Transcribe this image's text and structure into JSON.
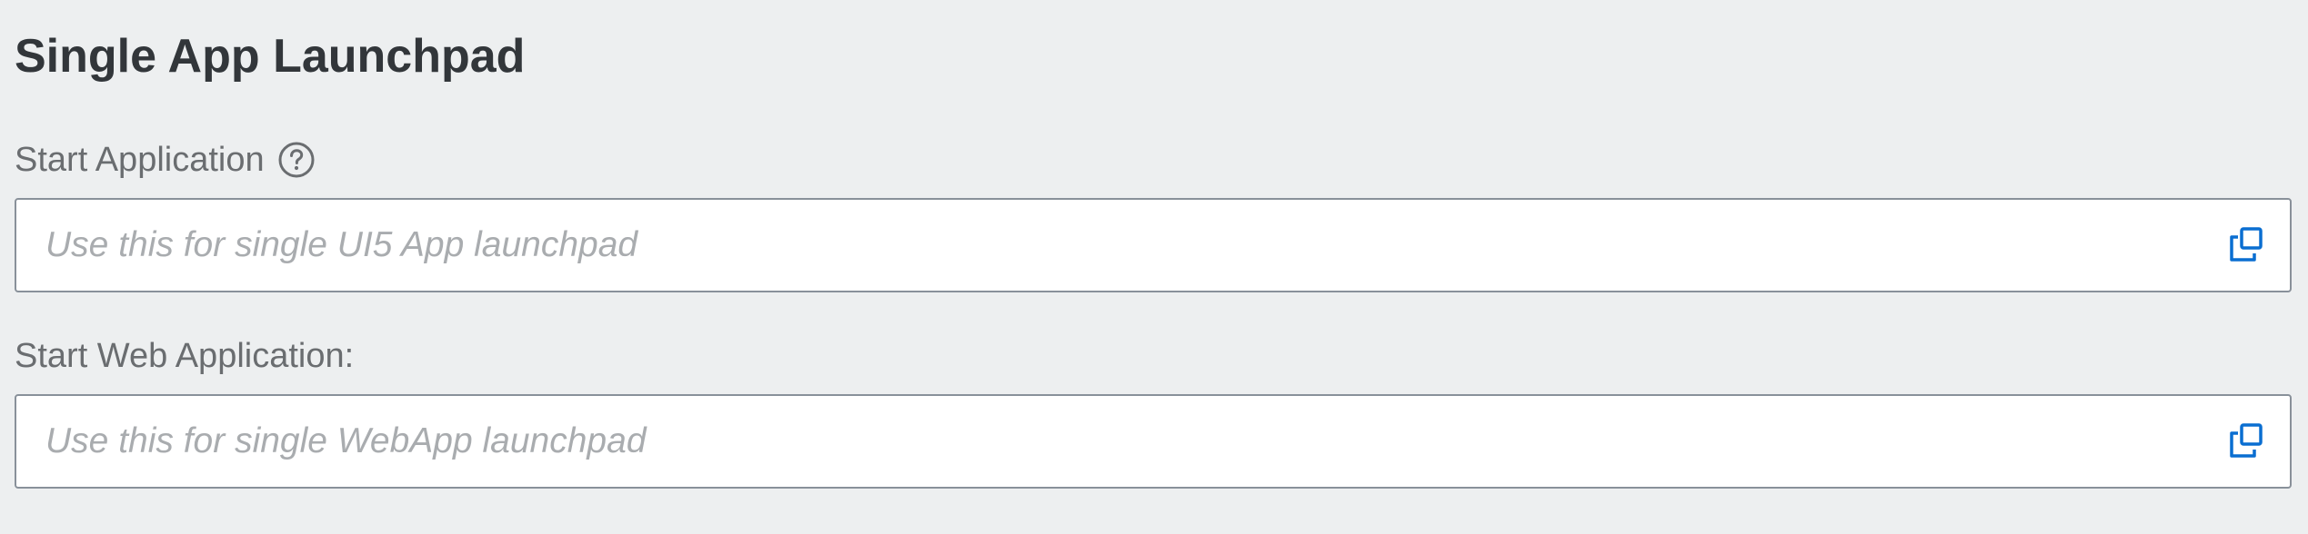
{
  "section": {
    "title": "Single App Launchpad"
  },
  "fields": [
    {
      "label": "Start Application",
      "has_help_icon": true,
      "value": "",
      "placeholder": "Use this for single UI5 App launchpad",
      "trailing_icon": "value-help-icon"
    },
    {
      "label": "Start Web Application:",
      "has_help_icon": false,
      "value": "",
      "placeholder": "Use this for single WebApp launchpad",
      "trailing_icon": "value-help-icon"
    }
  ],
  "colors": {
    "background": "#edeff0",
    "title_text": "#32363a",
    "label_text": "#6a6d70",
    "placeholder_text": "#a9acaf",
    "input_border": "#89919a",
    "icon_accent": "#0a6ed1"
  }
}
